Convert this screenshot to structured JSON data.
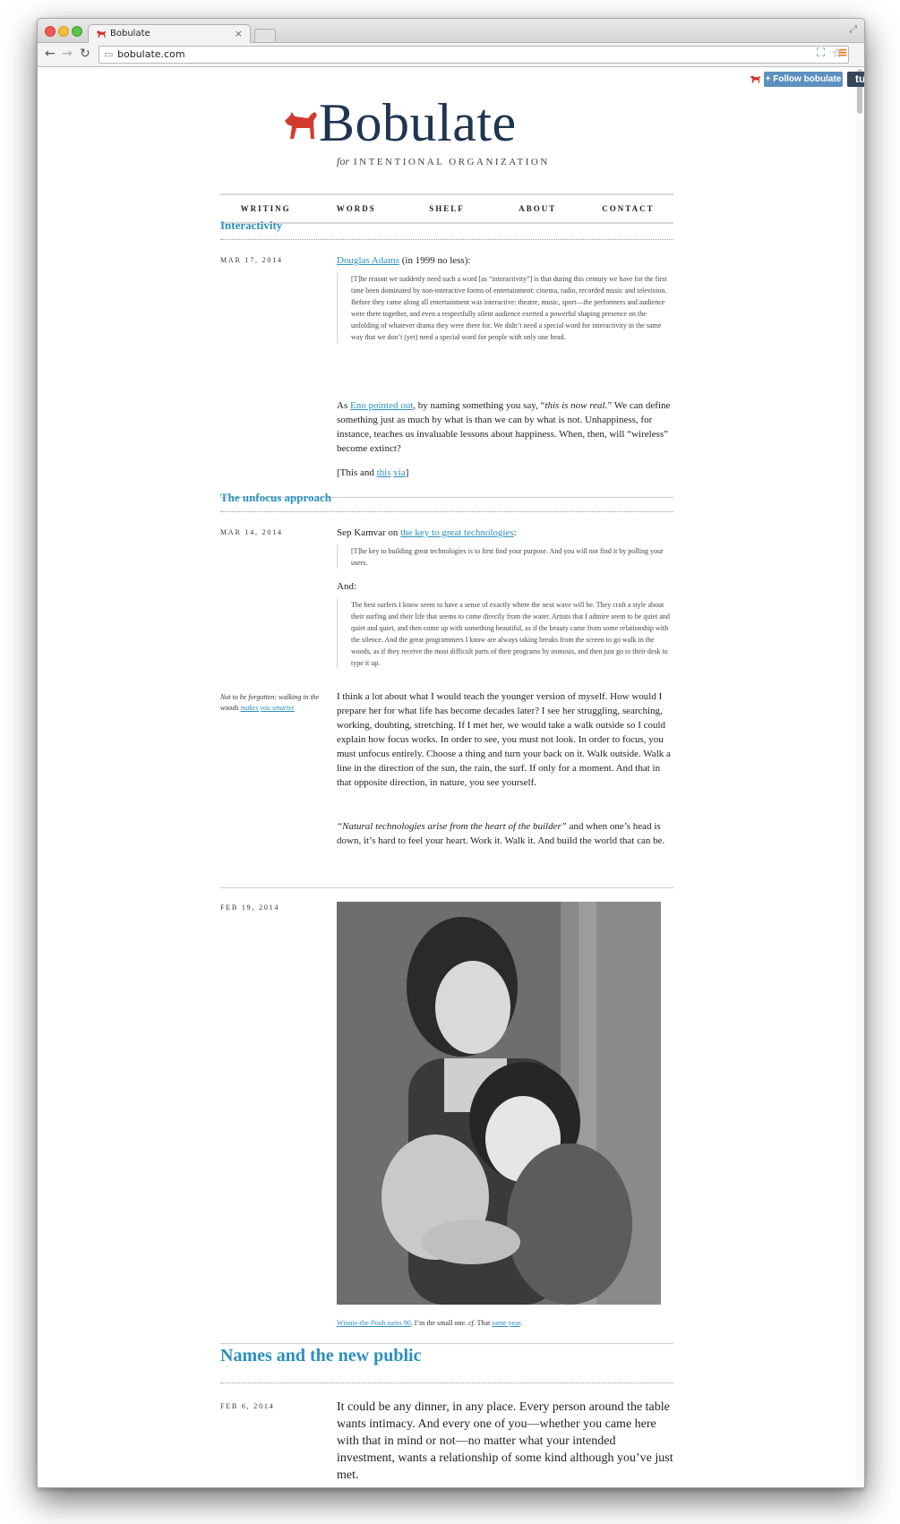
{
  "browser": {
    "tab_title": "Bobulate",
    "tab_close": "×",
    "url": "bobulate.com",
    "back_icon": "←",
    "forward_icon": "→",
    "reload_icon": "↻",
    "star_icon": "☆",
    "ext_icon": "⛶",
    "menu_icon": "≡",
    "fullscreen_icon": "⤢"
  },
  "tumblr": {
    "follow_label": "+ Follow bobulate",
    "tumblr_label": "tumblr."
  },
  "site": {
    "title": "Bobulate",
    "tagline_for": "for",
    "tagline_rest": "INTENTIONAL ORGANIZATION",
    "accent_color": "#2a8fbd",
    "dog_color": "#d23a2f"
  },
  "nav": [
    "WRITING",
    "WORDS",
    "SHELF",
    "ABOUT",
    "CONTACT"
  ],
  "posts": {
    "p1": {
      "title": "Interactivity",
      "date": "MAR 17, 2014",
      "intro_link": "Douglas Adams",
      "intro_rest": " (in 1999 no less):",
      "quote": "[T]he reason we suddenly need such a word [as “interactivity”] is that during this century we have for the first time been dominated by non-interactive forms of entertainment: cinema, radio, recorded music and television. Before they came along all entertainment was interactive: theatre, music, sport—the performers and audience were there together, and even a respectfully silent audience exerted a powerful shaping presence on the unfolding of whatever drama they were there for. We didn’t need a special word for interactivity in the same way that we don’t (yet) need a special word for people with only one head.",
      "para_a": "As ",
      "para_link": "Eno pointed out",
      "para_b": ", by naming something you say, “",
      "para_em": "this is now real.",
      "para_c": "” We can define something just as much by what is than we can by what is not. Unhappiness, for instance, teaches us invaluable lessons about happiness. When, then, will “wireless” become extinct?",
      "via_a": "[This and ",
      "via_link1": "this",
      "via_link2": "via",
      "via_c": "]"
    },
    "p2": {
      "title": "The unfocus approach",
      "date": "MAR 14, 2014",
      "intro_a": "Sep Kamvar on ",
      "intro_link": "the key to great technologies",
      "intro_c": ":",
      "quote1": "[T]he key to building great technologies is to first find your purpose. And you will not find it by polling your users.",
      "and": "And:",
      "quote2": "The best surfers I know seem to have a sense of exactly where the next wave will be. They craft a style about their surfing and their life that seems to come directly from the water. Artists that I admire seem to be quiet and quiet and quiet, and then come up with something beautiful, as if the beauty came from some relationship with the silence. And the great programmers I know are always taking breaks from the screen to go walk in the woods, as if they receive the most difficult parts of their programs by osmosis, and then just go to their desk to type it up.",
      "side_a": "Not to be forgotten: walking in the woods ",
      "side_link": "makes you smarter",
      "para": "I think a lot about what I would teach the younger version of myself. How would I prepare her for what life has become decades later? I see her struggling, searching, working, doubting, stretching. If I met her, we would take a walk outside so I could explain how focus works. In order to see, you must not look. In order to focus, you must unfocus entirely. Choose a thing and turn your back on it. Walk outside. Walk a line in the direction of the sun, the rain, the surf. If only for a moment. And that in that opposite direction, in nature, you see yourself.",
      "closing_em": "“Natural technologies arise from the heart of the builder”",
      "closing_rest": " and when one’s head is down, it’s hard to feel your heart. Work it. Walk it. And build the world that can be."
    },
    "p3": {
      "date": "FEB 19, 2014",
      "caption_link": "Winnie-the-Pooh turns 90",
      "caption_a": ". I’m the small one. ",
      "caption_em": "cf.",
      "caption_b": " That ",
      "caption_link2": "same year",
      "caption_c": "."
    },
    "p4": {
      "title": "Names and the new public",
      "date": "FEB 6, 2014",
      "para": "It could be any dinner, in any place. Every person around the table wants intimacy. And every one of you—whether you came here with that in mind or not—no matter what your intended investment, wants a relationship of some kind although you’ve just met."
    }
  }
}
